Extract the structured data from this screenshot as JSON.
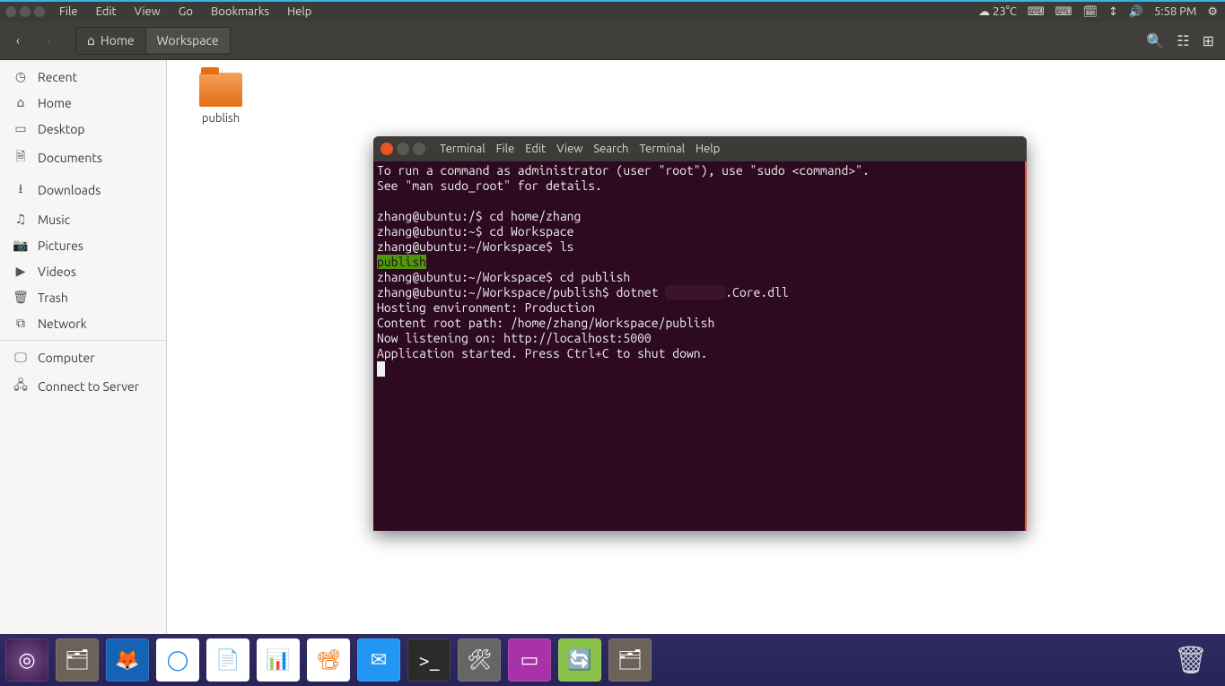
{
  "top_panel": {
    "menu": [
      "File",
      "Edit",
      "View",
      "Go",
      "Bookmarks",
      "Help"
    ],
    "weather": "23°C",
    "time": "5:58 PM"
  },
  "nautilus": {
    "breadcrumb_home": "Home",
    "breadcrumb_current": "Workspace",
    "folder_label": "publish"
  },
  "sidebar": {
    "items": [
      {
        "label": "Recent",
        "icon": "◷"
      },
      {
        "label": "Home",
        "icon": "⌂"
      },
      {
        "label": "Desktop",
        "icon": "▭"
      },
      {
        "label": "Documents",
        "icon": "🗎"
      },
      {
        "label": "Downloads",
        "icon": "⭳"
      },
      {
        "label": "Music",
        "icon": "♫"
      },
      {
        "label": "Pictures",
        "icon": "📷"
      },
      {
        "label": "Videos",
        "icon": "▶"
      },
      {
        "label": "Trash",
        "icon": "🗑"
      },
      {
        "label": "Network",
        "icon": "⧉"
      },
      {
        "label": "Computer",
        "icon": "🖵"
      },
      {
        "label": "Connect to Server",
        "icon": "🖧"
      }
    ]
  },
  "terminal": {
    "menu": [
      "Terminal",
      "File",
      "Edit",
      "View",
      "Search",
      "Terminal",
      "Help"
    ],
    "lines": {
      "l0": "To run a command as administrator (user \"root\"), use \"sudo <command>\".",
      "l1": "See \"man sudo_root\" for details.",
      "l2": "",
      "l3": "zhang@ubuntu:/$ cd home/zhang",
      "l4": "zhang@ubuntu:~$ cd Workspace",
      "l5": "zhang@ubuntu:~/Workspace$ ls",
      "l6": "publish",
      "l7": "zhang@ubuntu:~/Workspace$ cd publish",
      "l8a": "zhang@ubuntu:~/Workspace/publish$ dotnet ",
      "l8b": "        ",
      "l8c": ".Core.dll",
      "l9": "Hosting environment: Production",
      "l10": "Content root path: /home/zhang/Workspace/publish",
      "l11": "Now listening on: http://localhost:5000",
      "l12": "Application started. Press Ctrl+C to shut down."
    }
  }
}
